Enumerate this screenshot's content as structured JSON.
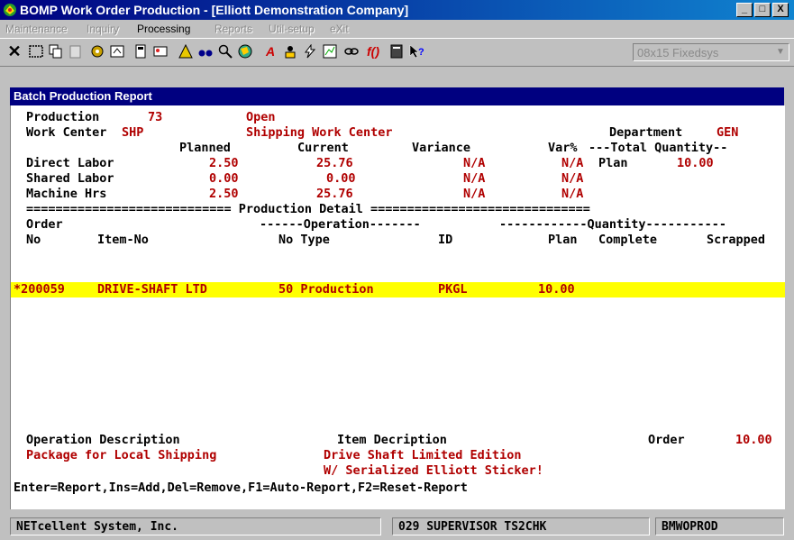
{
  "window": {
    "title": "BOMP Work Order Production - [Elliott Demonstration Company]",
    "min": "_",
    "max": "□",
    "close": "X"
  },
  "menu": [
    "Maintenance",
    "Inquiry",
    "Processing",
    "Reports",
    "Util-setup",
    "eXit"
  ],
  "toolbar": {
    "font_select": "08x15 Fixedsys",
    "icons": [
      "close-x",
      "window",
      "copy",
      "paste",
      "settings",
      "properties",
      "calculator",
      "user-card",
      "warning",
      "binoculars",
      "search",
      "globe",
      "font",
      "person",
      "lightning",
      "chart",
      "link",
      "function",
      "book",
      "help-pointer"
    ]
  },
  "report": {
    "title": "Batch Production Report",
    "production_label": "Production",
    "production_no": "73",
    "production_status": "Open",
    "workcenter_label": "Work Center",
    "workcenter_code": "SHP",
    "workcenter_name": "Shipping Work Center",
    "department_label": "Department",
    "department_code": "GEN",
    "col_planned": "Planned",
    "col_current": "Current",
    "col_variance": "Variance",
    "col_varpct": "Var%",
    "total_qty_header": "---Total Quantity--",
    "rows": [
      {
        "label": "Direct Labor",
        "planned": "2.50",
        "current": "25.76",
        "variance": "N/A",
        "varpct": "N/A"
      },
      {
        "label": "Shared Labor",
        "planned": "0.00",
        "current": "0.00",
        "variance": "N/A",
        "varpct": "N/A"
      },
      {
        "label": "Machine Hrs",
        "planned": "2.50",
        "current": "25.76",
        "variance": "N/A",
        "varpct": "N/A"
      }
    ],
    "plan_label": "Plan",
    "plan_value": "10.00",
    "detail_separator": "============================ Production Detail ==============================",
    "hdr1_order": "Order",
    "hdr1_operation": "------Operation-------",
    "hdr1_quantity": "------------Quantity-----------",
    "hdr2_no": "No",
    "hdr2_item": "Item-No",
    "hdr2_opno": "No Type",
    "hdr2_id": "ID",
    "hdr2_plan": "Plan",
    "hdr2_complete": "Complete",
    "hdr2_scrapped": "Scrapped",
    "detail": {
      "order": "*200059",
      "item": "DRIVE-SHAFT LTD",
      "op": "50 Production",
      "id": "PKGL",
      "plan": "10.00"
    },
    "op_desc_label": "Operation Description",
    "op_desc": "Package for Local Shipping",
    "item_desc_label": "Item Decription",
    "item_desc_1": "Drive Shaft Limited Edition",
    "item_desc_2": "W/ Serialized Elliott Sticker!",
    "order_label": "Order",
    "order_value": "10.00",
    "keys_hint": "Enter=Report,Ins=Add,Del=Remove,F1=Auto-Report,F2=Reset-Report"
  },
  "status": {
    "company": "NETcellent System, Inc.",
    "user": "029 SUPERVISOR TS2CHK",
    "program": "BMWOPROD"
  },
  "colors": {
    "title_bar": "#000080",
    "terminal_bg": "#ffffff",
    "value_red": "#b00000",
    "highlight": "#ffff00"
  }
}
